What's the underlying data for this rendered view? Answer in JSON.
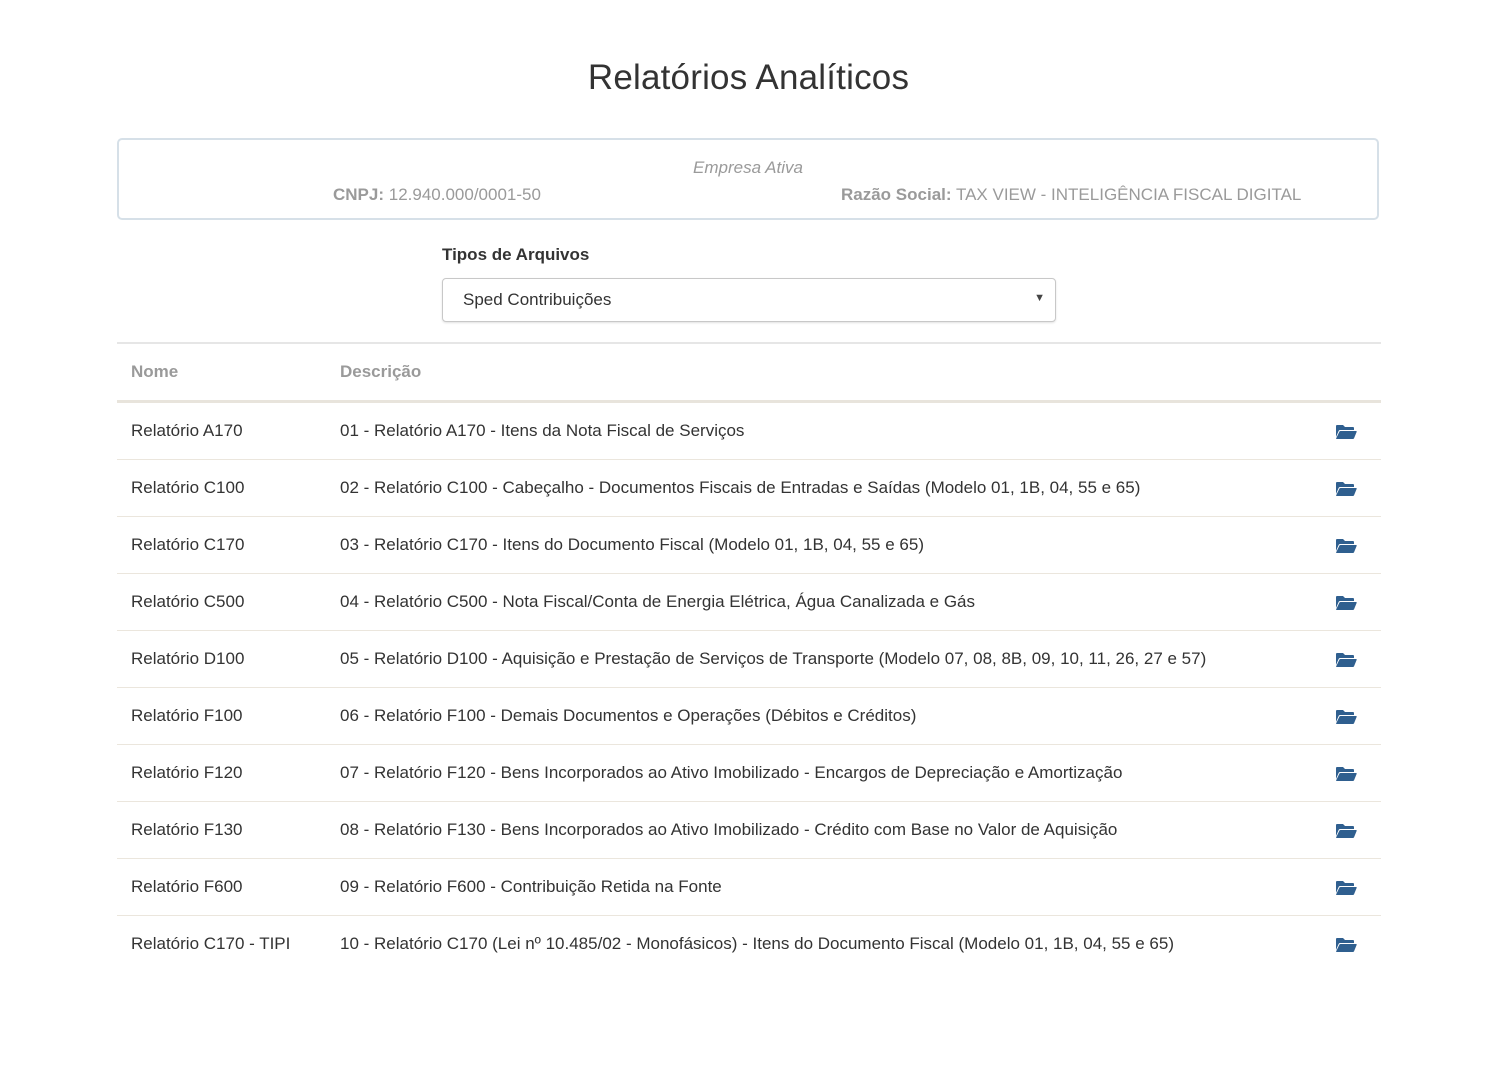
{
  "page": {
    "title": "Relatórios Analíticos"
  },
  "company": {
    "heading": "Empresa Ativa",
    "cnpj_label": "CNPJ:",
    "cnpj_value": "12.940.000/0001-50",
    "razao_label": "Razão Social:",
    "razao_value": "TAX VIEW - INTELIGÊNCIA FISCAL DIGITAL"
  },
  "filetype": {
    "label": "Tipos de Arquivos",
    "selected": "Sped Contribuições",
    "caret_icon": "chevron-down-icon"
  },
  "table": {
    "headers": {
      "name": "Nome",
      "description": "Descrição"
    },
    "action_icon": "folder-open-icon",
    "action_icon_color": "#2f5f8f",
    "rows": [
      {
        "name": "Relatório A170",
        "description": "01 - Relatório A170 - Itens da Nota Fiscal de Serviços"
      },
      {
        "name": "Relatório C100",
        "description": "02 - Relatório C100 - Cabeçalho - Documentos Fiscais de Entradas e Saídas (Modelo 01, 1B, 04, 55 e 65)"
      },
      {
        "name": "Relatório C170",
        "description": "03 - Relatório C170 - Itens do Documento Fiscal (Modelo 01, 1B, 04, 55 e 65)"
      },
      {
        "name": "Relatório C500",
        "description": "04 - Relatório C500 - Nota Fiscal/Conta de Energia Elétrica, Água Canalizada e Gás"
      },
      {
        "name": "Relatório D100",
        "description": "05 - Relatório D100 - Aquisição e Prestação de Serviços de Transporte (Modelo 07, 08, 8B, 09, 10, 11, 26, 27 e 57)"
      },
      {
        "name": "Relatório F100",
        "description": "06 - Relatório F100 - Demais Documentos e Operações (Débitos e Créditos)"
      },
      {
        "name": "Relatório F120",
        "description": "07 - Relatório F120 - Bens Incorporados ao Ativo Imobilizado - Encargos de Depreciação e Amortização"
      },
      {
        "name": "Relatório F130",
        "description": "08 - Relatório F130 - Bens Incorporados ao Ativo Imobilizado - Crédito com Base no Valor de Aquisição"
      },
      {
        "name": "Relatório F600",
        "description": "09 - Relatório F600 - Contribuição Retida na Fonte"
      },
      {
        "name": "Relatório C170 - TIPI",
        "description": "10 - Relatório C170 (Lei nº 10.485/02 - Monofásicos) - Itens do Documento Fiscal (Modelo 01, 1B, 04, 55 e 65)"
      }
    ]
  }
}
